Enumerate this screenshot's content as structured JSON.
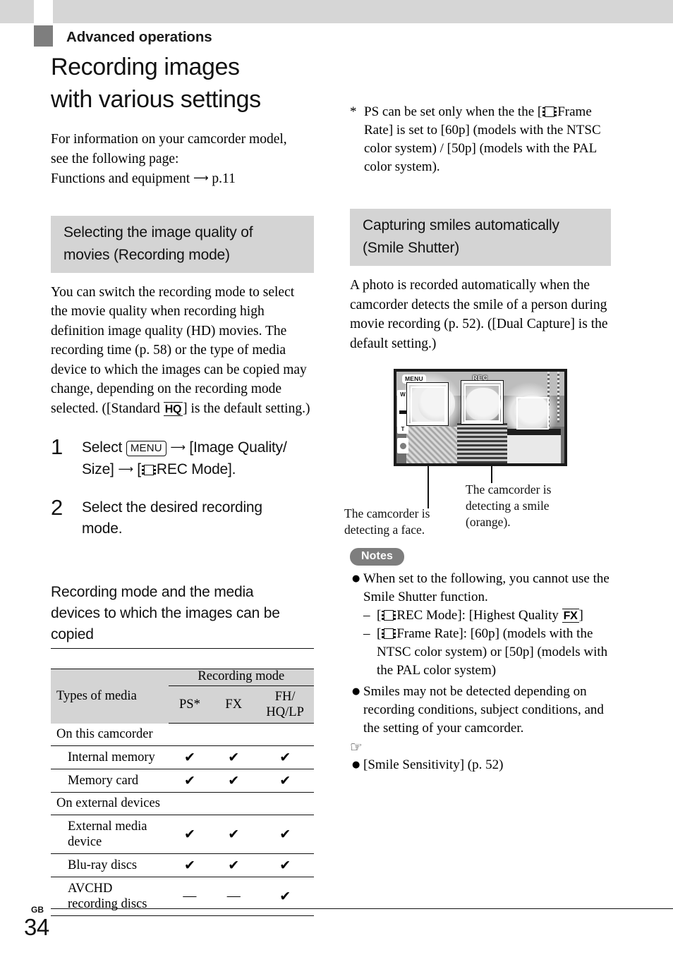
{
  "chapter": {
    "label": "Advanced operations"
  },
  "page_title": {
    "line1": "Recording images",
    "line2": "with various settings"
  },
  "intro": {
    "line1": "For information on your camcorder model,",
    "line2": "see the following page:",
    "line3_pre": "Functions and equipment",
    "line3_post": "p.11"
  },
  "section_movie_quality": {
    "heading_line1": "Selecting the image quality of",
    "heading_line2": "movies (Recording mode)",
    "body_pre": "You can switch the recording mode to select the movie quality when recording high definition image quality (HD) movies. The recording time (p. 58) or the type of media device to which the images can be copied may change, depending on the recording mode selected. ([Standard",
    "body_tag": "HQ",
    "body_post": "] is the default setting.)"
  },
  "steps": [
    {
      "num": "1",
      "pre": "Select",
      "menu_label": "MENU",
      "mid": "[Image Quality/ Size]",
      "post": "REC Mode]."
    },
    {
      "num": "2",
      "text_line1": "Select the desired recording",
      "text_line2": "mode."
    }
  ],
  "subsection": {
    "heading_line1": "Recording mode and the media",
    "heading_line2": "devices to which the images can be",
    "heading_line3": "copied"
  },
  "table": {
    "col_types_header": "Types of media",
    "group_header": "Recording mode",
    "mode_columns": [
      "PS*",
      "FX",
      "FH/ HQ/LP"
    ],
    "mode_col_ps": "PS*",
    "mode_col_fx": "FX",
    "mode_col_fh_line1": "FH/",
    "mode_col_fh_line2": "HQ/LP",
    "rows": [
      {
        "type": "category",
        "label": "On this camcorder",
        "values": [
          "",
          "",
          ""
        ]
      },
      {
        "type": "item",
        "label": "Internal memory",
        "values": [
          "✔",
          "✔",
          "✔"
        ]
      },
      {
        "type": "item",
        "label": "Memory card",
        "values": [
          "✔",
          "✔",
          "✔"
        ]
      },
      {
        "type": "category",
        "label": "On external devices",
        "values": [
          "",
          "",
          ""
        ]
      },
      {
        "type": "item",
        "label_line1": "External media",
        "label_line2": "device",
        "label": "External media device",
        "values": [
          "✔",
          "✔",
          "✔"
        ]
      },
      {
        "type": "item",
        "label": "Blu-ray discs",
        "values": [
          "✔",
          "✔",
          "✔"
        ]
      },
      {
        "type": "item",
        "label_line1": "AVCHD",
        "label_line2": "recording discs",
        "label": "AVCHD recording discs",
        "values": [
          "—",
          "—",
          "✔"
        ]
      }
    ]
  },
  "footnote": {
    "marker": "*",
    "pre": "PS can be set only when the the [",
    "post": "Frame Rate] is set to [60p] (models with the NTSC color system) / [50p] (models with the PAL color system)."
  },
  "section_smile": {
    "heading_line1": "Capturing smiles automatically",
    "heading_line2": "(Smile Shutter)",
    "body": "A photo is recorded automatically when the camcorder detects the smile of a person during movie recording (p. 52). ([Dual Capture] is the default setting.)"
  },
  "figure": {
    "menu_chip": "MENU",
    "rec_chip": "REC",
    "zoom_wide": "W",
    "zoom_tele": "T",
    "caption_face_line1": "The camcorder is",
    "caption_face_line2": "detecting a face.",
    "caption_smile_line1": "The camcorder is",
    "caption_smile_line2": "detecting a smile",
    "caption_smile_line3": "(orange)."
  },
  "notes": {
    "pill": "Notes",
    "items": [
      {
        "text": "When set to the following, you cannot use the Smile Shutter function.",
        "sub": [
          {
            "pre": "[",
            "post": "REC Mode]: [Highest Quality",
            "tag": "FX",
            "tail": "]"
          },
          {
            "pre": "[",
            "post": "Frame Rate]: [60p] (models with the NTSC color system) or [50p] (models with the PAL color system)"
          }
        ]
      },
      {
        "text": "Smiles may not be detected depending on recording conditions, subject conditions, and the setting of your camcorder."
      }
    ],
    "see_also_icon": "☞",
    "see_also": "[Smile Sensitivity] (p. 52)"
  },
  "footer": {
    "gb": "GB",
    "page_number": "34"
  }
}
